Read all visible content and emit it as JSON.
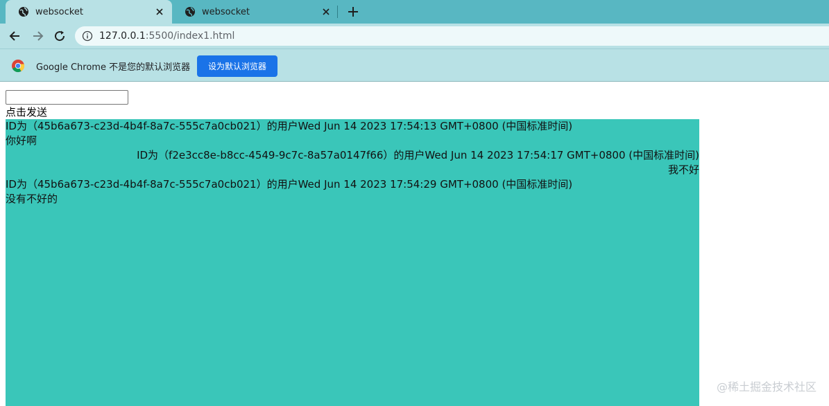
{
  "tabs": [
    {
      "title": "websocket",
      "active": true
    },
    {
      "title": "websocket",
      "active": false
    }
  ],
  "address_bar": {
    "host": "127.0.0.1",
    "path": ":5500/index1.html"
  },
  "infobar": {
    "message": "Google Chrome 不是您的默认浏览器",
    "button_label": "设为默认浏览器"
  },
  "page": {
    "input": {
      "value": "",
      "placeholder": ""
    },
    "send_label": "点击发送",
    "messages": [
      {
        "header": "ID为（45b6a673-c23d-4b4f-8a7c-555c7a0cb021）的用户Wed Jun 14 2023 17:54:13 GMT+0800 (中国标准时间)",
        "text": "你好啊",
        "align": "left"
      },
      {
        "header": "ID为（f2e3cc8e-b8cc-4549-9c7c-8a57a0147f66）的用户Wed Jun 14 2023 17:54:17 GMT+0800 (中国标准时间)",
        "text": "我不好",
        "align": "right"
      },
      {
        "header": "ID为（45b6a673-c23d-4b4f-8a7c-555c7a0cb021）的用户Wed Jun 14 2023 17:54:29 GMT+0800 (中国标准时间)",
        "text": "没有不好的",
        "align": "left"
      }
    ],
    "chat_background": "#3ac6b9"
  },
  "watermark": "@稀土掘金技术社区",
  "icons": {
    "tab_favicon": "globe-icon",
    "tab_close": "close-icon",
    "new_tab": "plus-icon",
    "back": "back-arrow-icon",
    "forward": "forward-arrow-icon",
    "reload": "reload-icon",
    "site_info": "info-icon",
    "chrome": "chrome-logo-icon"
  },
  "colors": {
    "tabstrip": "#58b7c2",
    "toolbar": "#b8e1e5",
    "accent_button": "#1a73e8"
  }
}
